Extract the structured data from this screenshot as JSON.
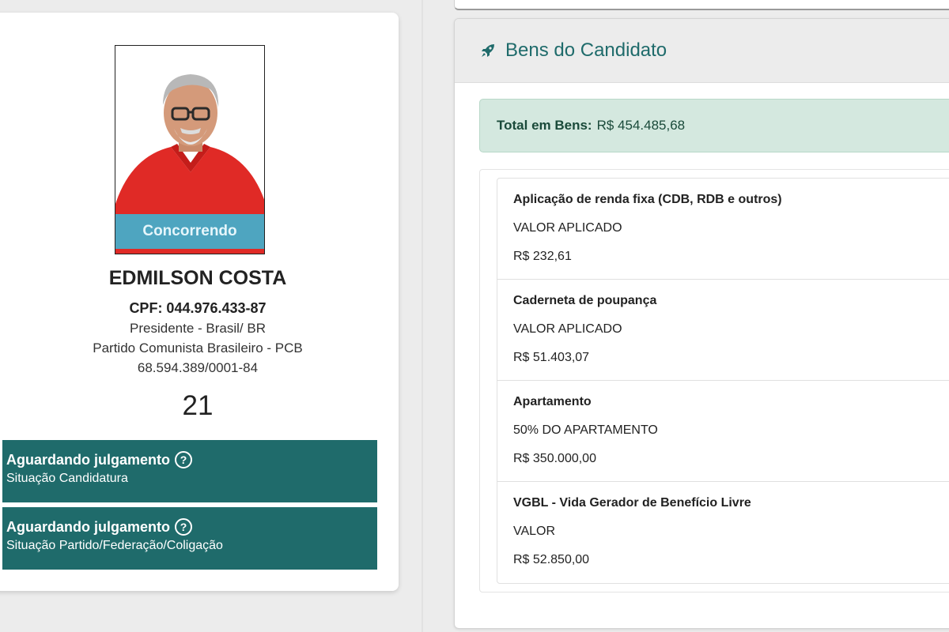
{
  "candidate": {
    "status_badge": "Concorrendo",
    "name": "EDMILSON COSTA",
    "cpf": "CPF: 044.976.433-87",
    "office": "Presidente - Brasil/ BR",
    "party": "Partido Comunista Brasileiro - PCB",
    "cnpj": "68.594.389/0001-84",
    "number": "21",
    "statuses": [
      {
        "title": "Aguardando julgamento",
        "subtitle": "Situação Candidatura"
      },
      {
        "title": "Aguardando julgamento",
        "subtitle": "Situação Partido/Federação/Coligação"
      }
    ]
  },
  "assets": {
    "header_title": "Bens do Candidato",
    "total_label": "Total em Bens:",
    "total_value": "R$ 454.485,68",
    "items": [
      {
        "title": "Aplicação de renda fixa (CDB, RDB e outros)",
        "description": "VALOR APLICADO",
        "value": "R$ 232,61"
      },
      {
        "title": "Caderneta de poupança",
        "description": "VALOR APLICADO",
        "value": "R$ 51.403,07"
      },
      {
        "title": "Apartamento",
        "description": "50% DO APARTAMENTO",
        "value": "R$ 350.000,00"
      },
      {
        "title": "VGBL - Vida Gerador de Benefício Livre",
        "description": "VALOR",
        "value": "R$ 52.850,00"
      }
    ]
  },
  "colors": {
    "primary_teal": "#1f6b6b",
    "badge_blue": "#41b0cd",
    "total_bg": "#d4e8df"
  }
}
